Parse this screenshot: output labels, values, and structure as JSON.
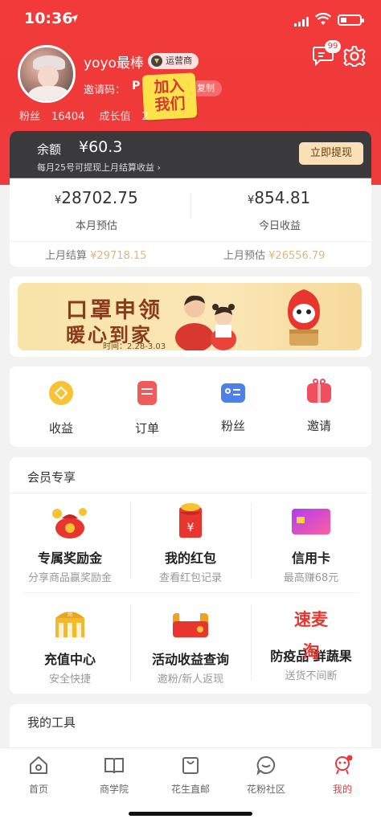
{
  "status_bar": {
    "time": "10:36"
  },
  "profile": {
    "username": "yoyo最棒",
    "role_badge": "运营商",
    "invite_label": "邀请码：",
    "invite_code": "P",
    "copy_label": "复制",
    "sticker_line1": "加入",
    "sticker_line2": "我们",
    "fans_label": "粉丝",
    "fans_count": "16404",
    "growth_label": "成长值",
    "growth_value": "2",
    "message_count": "99"
  },
  "balance": {
    "label": "余额",
    "value": "¥60.3",
    "note": "每月25号可提现上月结算收益 ›",
    "withdraw_label": "立即提现"
  },
  "earnings": {
    "month_symbol": "¥",
    "month_value": "28702.75",
    "month_label": "本月预估",
    "today_symbol": "¥",
    "today_value": "854.81",
    "today_label": "今日收益",
    "last_settle_label": "上月结算",
    "last_settle_value": "¥29718.15",
    "last_estimate_label": "上月预估",
    "last_estimate_value": "¥26556.79"
  },
  "banner": {
    "line1": "口罩申领",
    "line2": "暖心到家",
    "date": "时间：2.28-3.03"
  },
  "shortcuts": [
    {
      "label": "收益"
    },
    {
      "label": "订单"
    },
    {
      "label": "粉丝"
    },
    {
      "label": "邀请"
    }
  ],
  "member_section": {
    "title": "会员专享",
    "items": [
      {
        "title": "专属奖励金",
        "sub": "分享商品赢奖励金"
      },
      {
        "title": "我的红包",
        "sub": "查看红包记录"
      },
      {
        "title": "信用卡",
        "sub": "最高赚68元"
      },
      {
        "title": "充值中心",
        "sub": "安全快捷"
      },
      {
        "title": "活动收益查询",
        "sub": "邀粉/新人返现"
      },
      {
        "title": "防疫品 鲜蔬果",
        "sub": "送货不间断"
      }
    ],
    "brand_text": "速麦淘",
    "recharge_sign": "充"
  },
  "tools_section": {
    "title": "我的工具"
  },
  "tabbar": [
    {
      "label": "首页"
    },
    {
      "label": "商学院"
    },
    {
      "label": "花生直邮"
    },
    {
      "label": "花粉社区"
    },
    {
      "label": "我的"
    }
  ],
  "colors": {
    "brand_red": "#ee3b3b",
    "gold_text": "#d8b886",
    "dark_card": "#3a3a3c"
  }
}
